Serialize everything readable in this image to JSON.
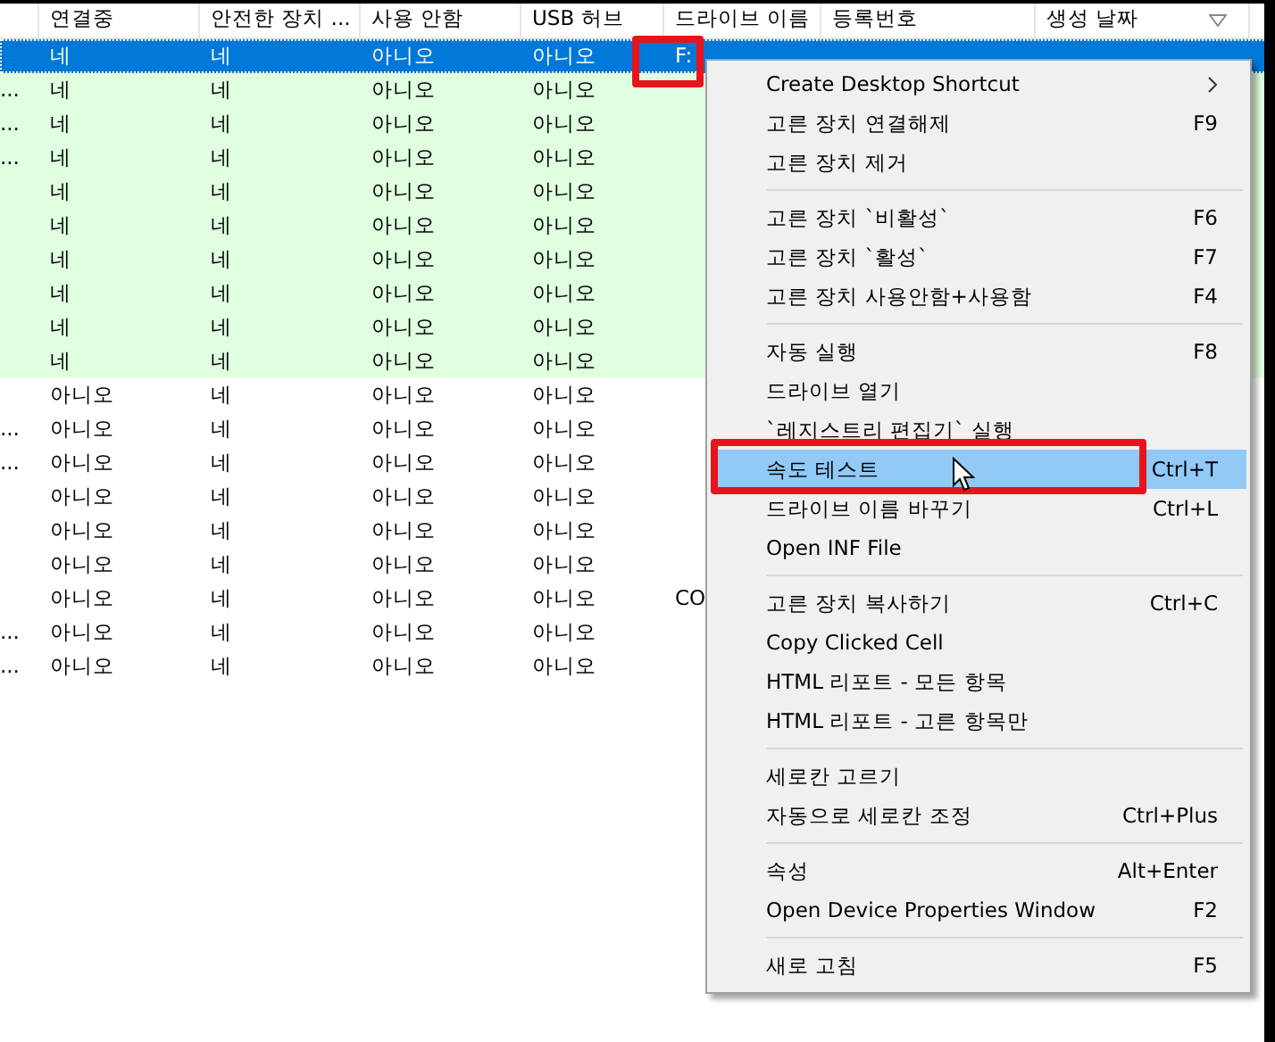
{
  "table": {
    "columns": [
      {
        "sorted": false
      },
      {
        "label": "연결중",
        "sorted": false
      },
      {
        "label": "안전한 장치 ...",
        "sorted": false
      },
      {
        "label": "사용 안함",
        "sorted": false
      },
      {
        "label": "USB 허브",
        "sorted": false
      },
      {
        "label": "드라이브 이름",
        "sorted": false
      },
      {
        "label": "등록번호",
        "sorted": false
      },
      {
        "label": "생성 날짜",
        "sorted": true
      }
    ],
    "rows": [
      {
        "selected": true,
        "color": "#0078d7",
        "cells": [
          null,
          "네",
          "네",
          "아니오",
          "아니오",
          "F:"
        ]
      },
      {
        "selected": false,
        "color": "#e0ffe0",
        "cells": [
          "...",
          "네",
          "네",
          "아니오",
          "아니오"
        ]
      },
      {
        "selected": false,
        "color": "#e0ffe0",
        "cells": [
          "...",
          "네",
          "네",
          "아니오",
          "아니오"
        ]
      },
      {
        "selected": false,
        "color": "#e0ffe0",
        "cells": [
          "...",
          "네",
          "네",
          "아니오",
          "아니오"
        ]
      },
      {
        "selected": false,
        "color": "#e0ffe0",
        "cells": [
          null,
          "네",
          "네",
          "아니오",
          "아니오"
        ]
      },
      {
        "selected": false,
        "color": "#e0ffe0",
        "cells": [
          null,
          "네",
          "네",
          "아니오",
          "아니오"
        ]
      },
      {
        "selected": false,
        "color": "#e0ffe0",
        "cells": [
          null,
          "네",
          "네",
          "아니오",
          "아니오"
        ]
      },
      {
        "selected": false,
        "color": "#e0ffe0",
        "cells": [
          null,
          "네",
          "네",
          "아니오",
          "아니오"
        ]
      },
      {
        "selected": false,
        "color": "#e0ffe0",
        "cells": [
          null,
          "네",
          "네",
          "아니오",
          "아니오"
        ]
      },
      {
        "selected": false,
        "color": "#e0ffe0",
        "cells": [
          null,
          "네",
          "네",
          "아니오",
          "아니오"
        ]
      },
      {
        "selected": false,
        "color": "#ffffff",
        "cells": [
          null,
          "아니오",
          "네",
          "아니오",
          "아니오"
        ]
      },
      {
        "selected": false,
        "color": "#ffffff",
        "cells": [
          "...",
          "아니오",
          "네",
          "아니오",
          "아니오"
        ]
      },
      {
        "selected": false,
        "color": "#ffffff",
        "cells": [
          "...",
          "아니오",
          "네",
          "아니오",
          "아니오"
        ]
      },
      {
        "selected": false,
        "color": "#ffffff",
        "cells": [
          null,
          "아니오",
          "네",
          "아니오",
          "아니오"
        ]
      },
      {
        "selected": false,
        "color": "#ffffff",
        "cells": [
          null,
          "아니오",
          "네",
          "아니오",
          "아니오"
        ]
      },
      {
        "selected": false,
        "color": "#ffffff",
        "cells": [
          null,
          "아니오",
          "네",
          "아니오",
          "아니오"
        ]
      },
      {
        "selected": false,
        "color": "#ffffff",
        "cells": [
          null,
          "아니오",
          "네",
          "아니오",
          "아니오",
          "CO"
        ]
      },
      {
        "selected": false,
        "color": "#ffffff",
        "cells": [
          "...",
          "아니오",
          "네",
          "아니오",
          "아니오"
        ]
      },
      {
        "selected": false,
        "color": "#ffffff",
        "cells": [
          "...",
          "아니오",
          "네",
          "아니오",
          "아니오"
        ]
      }
    ]
  },
  "context_menu": {
    "items": [
      {
        "kind": "item",
        "label": "Create Desktop Shortcut",
        "submenu": true,
        "selected": false
      },
      {
        "kind": "item",
        "label": "고른 장치 연결해제",
        "shortcut": "F9",
        "selected": false
      },
      {
        "kind": "item",
        "label": "고른 장치 제거",
        "selected": false
      },
      {
        "kind": "separator"
      },
      {
        "kind": "item",
        "label": "고른 장치 `비활성`",
        "shortcut": "F6",
        "selected": false
      },
      {
        "kind": "item",
        "label": "고른 장치 `활성`",
        "shortcut": "F7",
        "selected": false
      },
      {
        "kind": "item",
        "label": "고른 장치 사용안함+사용함",
        "shortcut": "F4",
        "selected": false
      },
      {
        "kind": "separator"
      },
      {
        "kind": "item",
        "label": "자동 실행",
        "shortcut": "F8",
        "selected": false
      },
      {
        "kind": "item",
        "label": "드라이브 열기",
        "selected": false
      },
      {
        "kind": "item",
        "label": "`레지스트리 편집기` 실행",
        "selected": false
      },
      {
        "kind": "item",
        "label": "속도 테스트",
        "shortcut": "Ctrl+T",
        "selected": true
      },
      {
        "kind": "item",
        "label": "드라이브 이름 바꾸기",
        "shortcut": "Ctrl+L",
        "selected": false
      },
      {
        "kind": "item",
        "label": "Open INF File",
        "selected": false
      },
      {
        "kind": "separator"
      },
      {
        "kind": "item",
        "label": "고른 장치 복사하기",
        "shortcut": "Ctrl+C",
        "selected": false
      },
      {
        "kind": "item",
        "label": "Copy Clicked Cell",
        "selected": false
      },
      {
        "kind": "item",
        "label": "HTML 리포트 - 모든 항목",
        "selected": false
      },
      {
        "kind": "item",
        "label": "HTML 리포트 - 고른 항목만",
        "selected": false
      },
      {
        "kind": "separator"
      },
      {
        "kind": "item",
        "label": "세로칸 고르기",
        "selected": false
      },
      {
        "kind": "item",
        "label": "자동으로 세로칸 조정",
        "shortcut": "Ctrl+Plus",
        "selected": false
      },
      {
        "kind": "separator"
      },
      {
        "kind": "item",
        "label": "속성",
        "shortcut": "Alt+Enter",
        "selected": false
      },
      {
        "kind": "item",
        "label": "Open Device Properties Window",
        "shortcut": "F2",
        "selected": false
      },
      {
        "kind": "separator"
      },
      {
        "kind": "item",
        "label": "새로 고침",
        "shortcut": "F5",
        "selected": false
      }
    ]
  }
}
